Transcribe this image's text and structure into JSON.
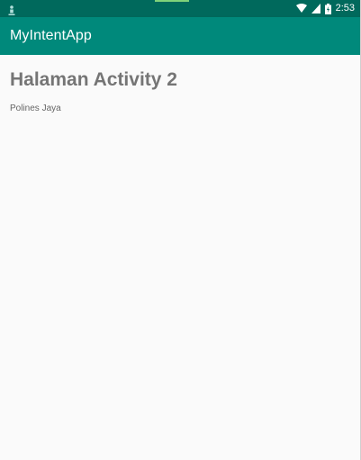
{
  "status_bar": {
    "time": "2:53",
    "icons": [
      "notification-icon",
      "wifi-icon",
      "signal-icon",
      "battery-icon"
    ],
    "background_color": "#00695c"
  },
  "app_bar": {
    "title": "MyIntentApp",
    "background_color": "#00897b"
  },
  "main": {
    "heading": "Halaman Activity 2",
    "subtext": "Polines Jaya"
  },
  "colors": {
    "page_background": "#fafafa",
    "heading_text": "#757575",
    "body_text": "#666666"
  }
}
